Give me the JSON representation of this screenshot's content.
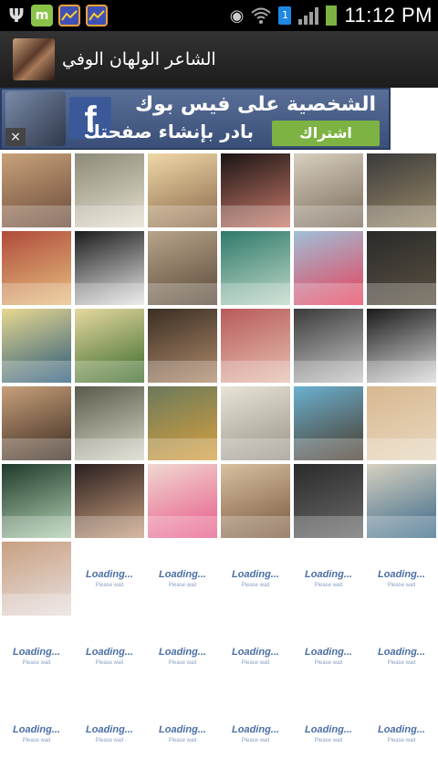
{
  "status_bar": {
    "time": "11:12 PM",
    "sim_slot": "1",
    "icons": [
      "usb-icon",
      "app-m-icon",
      "chart-app-icon",
      "chart-app-icon",
      "eye-icon",
      "wifi-icon",
      "sim-icon",
      "signal-icon",
      "battery-charging-icon"
    ]
  },
  "header": {
    "title": "الشاعر الولهان الوفي",
    "icon": "app-avatar"
  },
  "ad": {
    "line1": "الشخصية على فيس بوك",
    "line2": "بادر بإنشاء صفحتك",
    "subscribe_label": "اشتراك",
    "fb_logo": "f",
    "close_label": "×"
  },
  "grid": {
    "loading_label": "Loading...",
    "please_wait_label": "Please wait",
    "thumbnails": [
      {
        "colors": [
          "#c9a27a",
          "#6a4a3a"
        ]
      },
      {
        "colors": [
          "#8c8a78",
          "#e6e0cf"
        ]
      },
      {
        "colors": [
          "#f0d8a8",
          "#8a6a4a"
        ]
      },
      {
        "colors": [
          "#1a1414",
          "#c97a6a"
        ]
      },
      {
        "colors": [
          "#d8d0c0",
          "#7a6a5a"
        ]
      },
      {
        "colors": [
          "#3a3a3a",
          "#9a8a6a"
        ]
      },
      {
        "colors": [
          "#b04a3a",
          "#e6c080"
        ]
      },
      {
        "colors": [
          "#1c1c1c",
          "#e6e6e6"
        ]
      },
      {
        "colors": [
          "#b8a48a",
          "#5a4a3a"
        ]
      },
      {
        "colors": [
          "#2e7a6a",
          "#c0d8c8"
        ]
      },
      {
        "colors": [
          "#9ec0d8",
          "#e8405a"
        ]
      },
      {
        "colors": [
          "#2a2a2a",
          "#5a5040"
        ]
      },
      {
        "colors": [
          "#e8d890",
          "#2a5a7a"
        ]
      },
      {
        "colors": [
          "#e6d8a0",
          "#3a6a2a"
        ]
      },
      {
        "colors": [
          "#3a2e24",
          "#b08a6a"
        ]
      },
      {
        "colors": [
          "#b85a5a",
          "#e6c0b0"
        ]
      },
      {
        "colors": [
          "#3a3a3a",
          "#c8c8c8"
        ]
      },
      {
        "colors": [
          "#1a1a1a",
          "#dcdcdc"
        ]
      },
      {
        "colors": [
          "#c8a07a",
          "#3a2a20"
        ]
      },
      {
        "colors": [
          "#5a5a4a",
          "#d8d8c8"
        ]
      },
      {
        "colors": [
          "#6a7a5a",
          "#d8a040"
        ]
      },
      {
        "colors": [
          "#e8e4d8",
          "#9a9488"
        ]
      },
      {
        "colors": [
          "#6ab0d0",
          "#4a3a2a"
        ]
      },
      {
        "colors": [
          "#d8b890",
          "#e8d8c0"
        ]
      },
      {
        "colors": [
          "#1e3a2a",
          "#b0d0b0"
        ]
      },
      {
        "colors": [
          "#2a1e1e",
          "#c8a080"
        ]
      },
      {
        "colors": [
          "#f0d8d0",
          "#e85a8a"
        ]
      },
      {
        "colors": [
          "#d8c0a0",
          "#7a5a40"
        ]
      },
      {
        "colors": [
          "#2a2a2a",
          "#6a6a6a"
        ]
      },
      {
        "colors": [
          "#d8d0c0",
          "#3a6a8a"
        ]
      },
      {
        "colors": [
          "#c8a080",
          "#e8e0e0"
        ]
      }
    ],
    "loading_count": 17
  }
}
